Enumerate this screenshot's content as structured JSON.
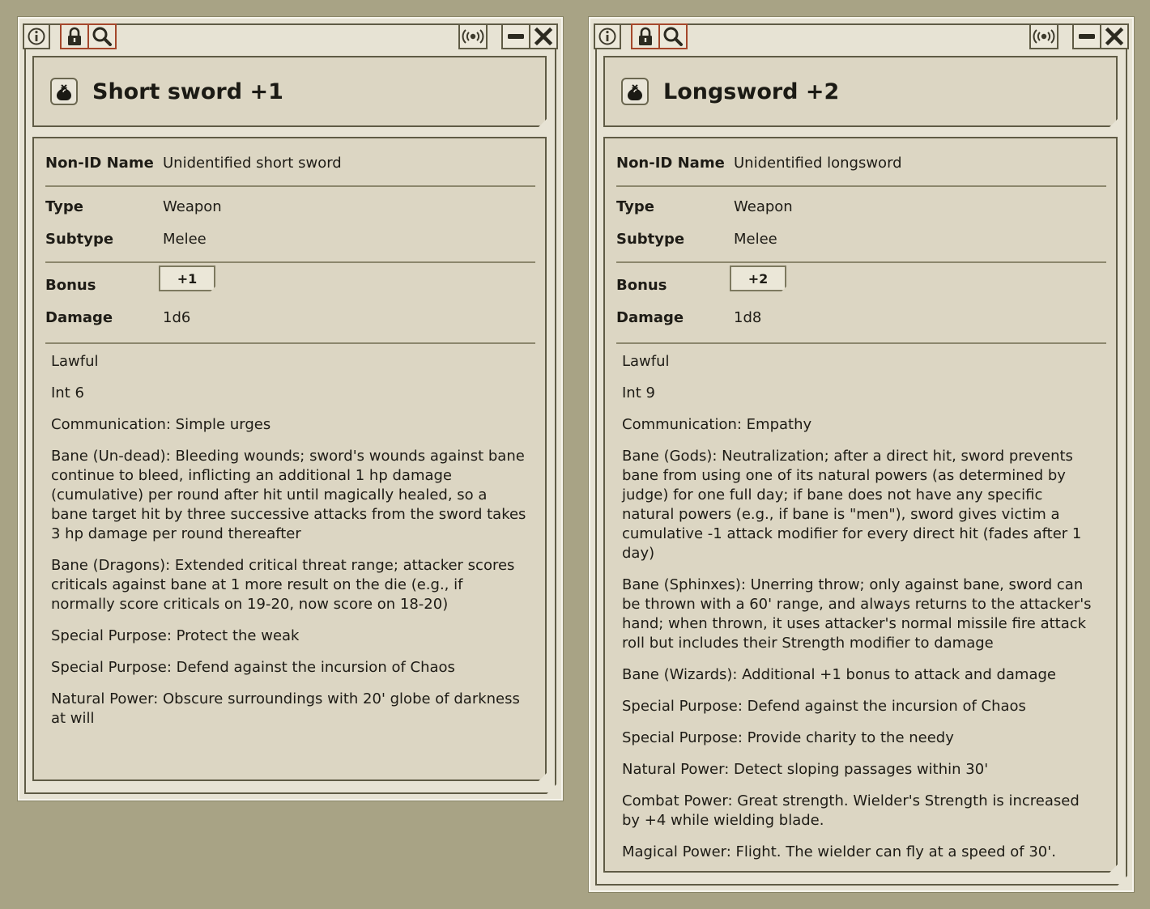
{
  "windows": [
    {
      "title": "Short sword +1",
      "fields": {
        "nonid_label": "Non-ID Name",
        "nonid_value": "Unidentified short sword",
        "type_label": "Type",
        "type_value": "Weapon",
        "subtype_label": "Subtype",
        "subtype_value": "Melee",
        "bonus_label": "Bonus",
        "bonus_value": "+1",
        "damage_label": "Damage",
        "damage_value": "1d6"
      },
      "properties": [
        "Lawful",
        "Int 6",
        "Communication: Simple urges",
        "Bane (Un-dead): Bleeding wounds; sword's wounds against bane continue to bleed, inflicting an additional 1 hp damage (cumulative) per round after hit until magically healed, so a bane target hit by three successive attacks from the sword takes 3 hp damage per round thereafter",
        "Bane (Dragons): Extended critical threat range; attacker scores criticals against bane at 1 more result on the die (e.g., if normally score criticals on 19-20, now score on 18-20)",
        "Special Purpose: Protect the weak",
        "Special Purpose: Defend against the incursion of Chaos",
        "Natural Power: Obscure surroundings with 20' globe of darkness at will"
      ]
    },
    {
      "title": "Longsword +2",
      "fields": {
        "nonid_label": "Non-ID Name",
        "nonid_value": "Unidentified longsword",
        "type_label": "Type",
        "type_value": "Weapon",
        "subtype_label": "Subtype",
        "subtype_value": "Melee",
        "bonus_label": "Bonus",
        "bonus_value": "+2",
        "damage_label": "Damage",
        "damage_value": "1d8"
      },
      "properties": [
        "Lawful",
        "Int 9",
        "Communication: Empathy",
        "Bane (Gods): Neutralization; after a direct hit, sword prevents bane from using one of its natural powers (as determined by judge) for one full day; if bane does not have any specific natural powers (e.g., if bane is \"men\"), sword gives victim a cumulative -1 attack modifier for every direct hit (fades after 1 day)",
        "Bane (Sphinxes): Unerring throw; only against bane, sword can be thrown with a 60' range, and always returns to the attacker's hand; when thrown, it uses attacker's normal missile fire attack roll but includes their Strength modifier to damage",
        "Bane (Wizards): Additional +1 bonus to attack and damage",
        "Special Purpose: Defend against the incursion of Chaos",
        "Special Purpose: Provide charity to the needy",
        "Natural Power: Detect sloping passages within 30'",
        "Combat Power: Great strength. Wielder's Strength is increased by +4 while wielding blade.",
        "Magical Power: Flight. The wielder can fly at a speed of 30'."
      ]
    }
  ],
  "colors": {
    "background": "#a8a385",
    "lock_accent": "#a4472b",
    "panel": "#dcd6c3"
  },
  "icons": [
    "info-icon",
    "lock-icon",
    "search-icon",
    "share-icon",
    "minimize-icon",
    "close-icon",
    "item-bag-icon"
  ]
}
